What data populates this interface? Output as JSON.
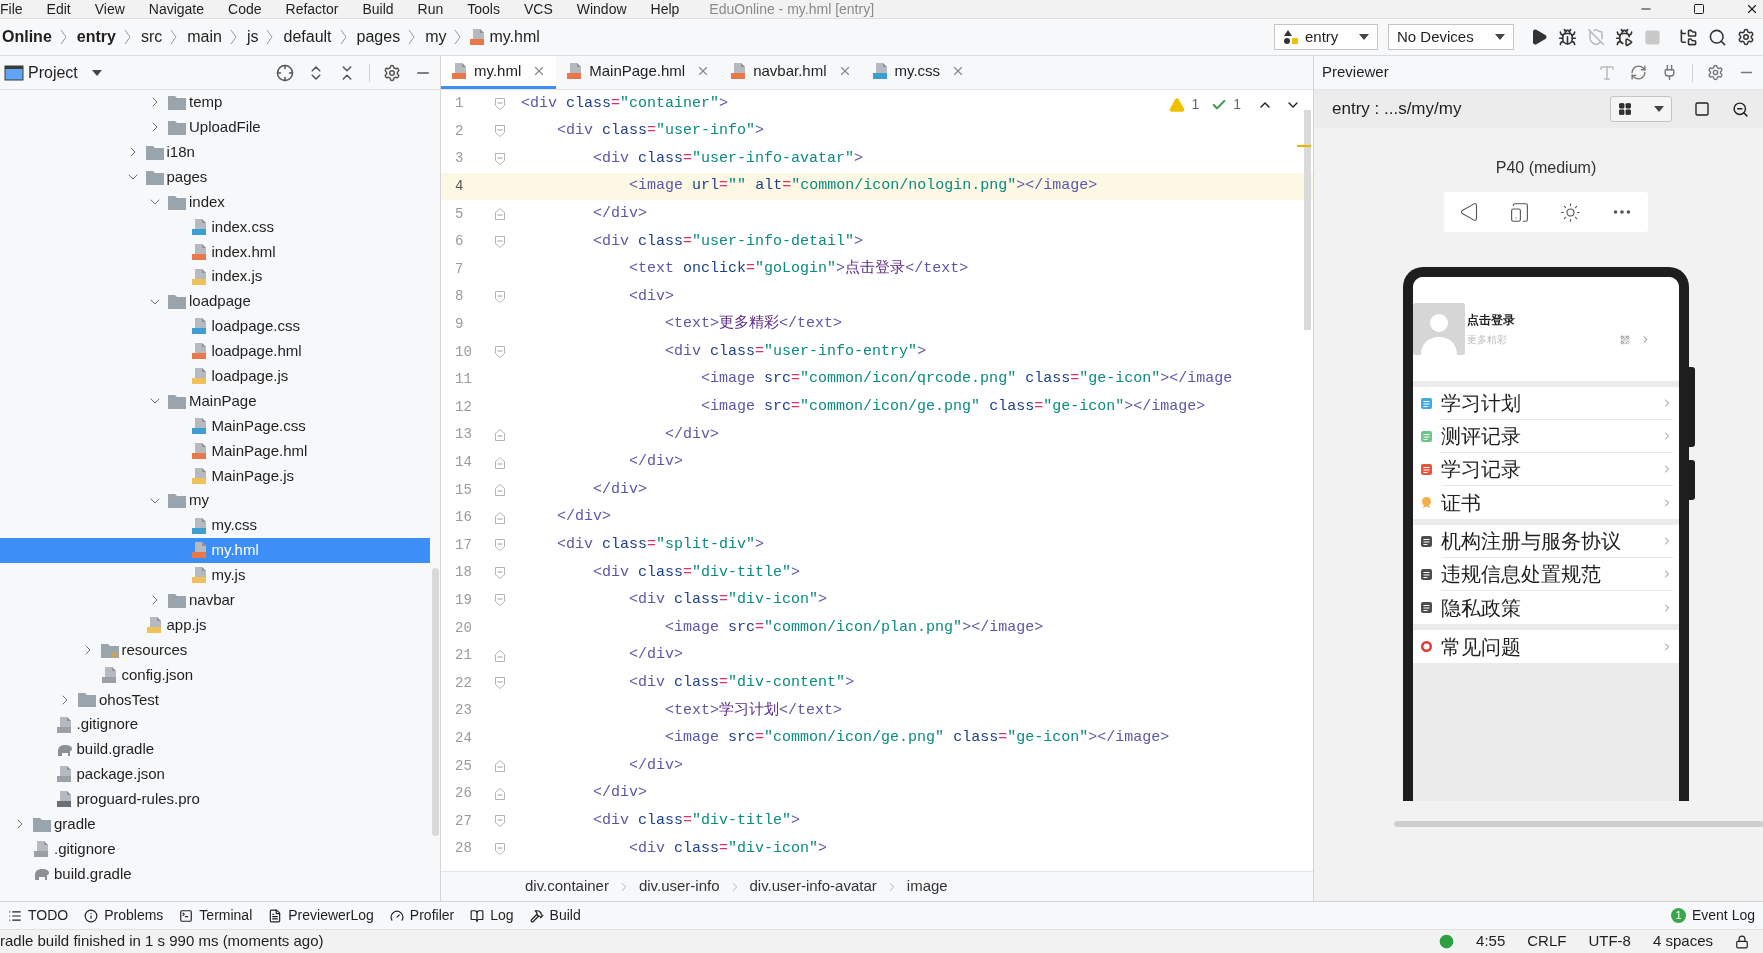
{
  "menu_bar": {
    "items": [
      "File",
      "Edit",
      "View",
      "Navigate",
      "Code",
      "Refactor",
      "Build",
      "Run",
      "Tools",
      "VCS",
      "Window",
      "Help"
    ],
    "title": "EduOnline - my.hml [entry]"
  },
  "breadcrumb": [
    {
      "label": "Online",
      "bold": true,
      "kind": "dir"
    },
    {
      "label": "entry",
      "bold": true,
      "kind": "dir"
    },
    {
      "label": "src",
      "bold": false,
      "kind": "dir"
    },
    {
      "label": "main",
      "bold": false,
      "kind": "dir"
    },
    {
      "label": "js",
      "bold": false,
      "kind": "dir"
    },
    {
      "label": "default",
      "bold": false,
      "kind": "dir"
    },
    {
      "label": "pages",
      "bold": false,
      "kind": "dir"
    },
    {
      "label": "my",
      "bold": false,
      "kind": "dir"
    },
    {
      "label": "my.hml",
      "bold": false,
      "kind": "hml"
    }
  ],
  "run_config": "entry",
  "device": "No Devices",
  "project_panel": {
    "title": "Project",
    "tree": [
      {
        "children": [
          {
            "children": [
              {
                "children": [
                  {
                    "children": [
                      {
                        "children": [
                          {
                            "children": [
                              {
                                "label": "temp",
                                "kind": "folder",
                                "expanded": false,
                                "selected": false
                              },
                              {
                                "label": "UploadFile",
                                "kind": "folder",
                                "expanded": false,
                                "selected": false
                              }
                            ]
                          },
                          {
                            "label": "i18n",
                            "kind": "folder",
                            "expanded": false,
                            "selected": false
                          },
                          {
                            "label": "pages",
                            "kind": "folder",
                            "expanded": true,
                            "selected": false,
                            "children": [
                              {
                                "label": "index",
                                "kind": "folder",
                                "expanded": true,
                                "selected": false,
                                "children": [
                                  {
                                    "label": "index.css",
                                    "kind": "css",
                                    "selected": false
                                  },
                                  {
                                    "label": "index.hml",
                                    "kind": "hml",
                                    "selected": false
                                  },
                                  {
                                    "label": "index.js",
                                    "kind": "js",
                                    "selected": false
                                  }
                                ]
                              },
                              {
                                "label": "loadpage",
                                "kind": "folder",
                                "expanded": true,
                                "selected": false,
                                "children": [
                                  {
                                    "label": "loadpage.css",
                                    "kind": "css",
                                    "selected": false
                                  },
                                  {
                                    "label": "loadpage.hml",
                                    "kind": "hml",
                                    "selected": false
                                  },
                                  {
                                    "label": "loadpage.js",
                                    "kind": "js",
                                    "selected": false
                                  }
                                ]
                              },
                              {
                                "label": "MainPage",
                                "kind": "folder",
                                "expanded": true,
                                "selected": false,
                                "children": [
                                  {
                                    "label": "MainPage.css",
                                    "kind": "css",
                                    "selected": false
                                  },
                                  {
                                    "label": "MainPage.hml",
                                    "kind": "hml",
                                    "selected": false
                                  },
                                  {
                                    "label": "MainPage.js",
                                    "kind": "js",
                                    "selected": false
                                  }
                                ]
                              },
                              {
                                "label": "my",
                                "kind": "folder",
                                "expanded": true,
                                "selected": false,
                                "children": [
                                  {
                                    "label": "my.css",
                                    "kind": "css",
                                    "selected": false
                                  },
                                  {
                                    "label": "my.hml",
                                    "kind": "hml",
                                    "selected": true
                                  },
                                  {
                                    "label": "my.js",
                                    "kind": "js",
                                    "selected": false
                                  }
                                ]
                              },
                              {
                                "label": "navbar",
                                "kind": "folder",
                                "expanded": false,
                                "selected": false
                              }
                            ]
                          },
                          {
                            "label": "app.js",
                            "kind": "js",
                            "selected": false
                          }
                        ]
                      }
                    ]
                  },
                  {
                    "label": "resources",
                    "kind": "resources",
                    "expanded": false,
                    "selected": false
                  },
                  {
                    "label": "config.json",
                    "kind": "json",
                    "selected": false
                  }
                ]
              },
              {
                "label": "ohosTest",
                "kind": "folder",
                "expanded": false,
                "selected": false
              }
            ]
          },
          {
            "label": ".gitignore",
            "kind": "ignore",
            "selected": false
          },
          {
            "label": "build.gradle",
            "kind": "gradle",
            "selected": false
          },
          {
            "label": "package.json",
            "kind": "json",
            "selected": false
          },
          {
            "label": "proguard-rules.pro",
            "kind": "text",
            "selected": false
          }
        ]
      },
      {
        "label": "gradle",
        "kind": "folder",
        "expanded": false,
        "selected": false
      },
      {
        "label": ".gitignore",
        "kind": "ignore",
        "selected": false
      },
      {
        "label": "build.gradle",
        "kind": "gradle",
        "selected": false
      }
    ]
  },
  "editor": {
    "tabs": [
      {
        "label": "my.hml",
        "kind": "hml",
        "selected": true
      },
      {
        "label": "MainPage.hml",
        "kind": "hml",
        "selected": false
      },
      {
        "label": "navbar.hml",
        "kind": "hml",
        "selected": false
      },
      {
        "label": "my.css",
        "kind": "css",
        "selected": false
      }
    ],
    "warnings": "1",
    "weak_warnings": "1",
    "lines": [
      {
        "number": "1",
        "text": "<div class=\"container\">",
        "kind": "open",
        "current": false
      },
      {
        "number": "2",
        "text": "    <div class=\"user-info\">",
        "kind": "open",
        "current": false
      },
      {
        "number": "3",
        "text": "        <div class=\"user-info-avatar\">",
        "kind": "open",
        "current": false
      },
      {
        "number": "4",
        "text": "            <image url=\"\" alt=\"common/icon/nologin.png\"></image>",
        "kind": "plain",
        "current": true
      },
      {
        "number": "5",
        "text": "        </div>",
        "kind": "close",
        "current": false
      },
      {
        "number": "6",
        "text": "        <div class=\"user-info-detail\">",
        "kind": "open",
        "current": false
      },
      {
        "number": "7",
        "text": "            <text onclick=\"goLogin\">点击登录</text>",
        "kind": "plain",
        "current": false
      },
      {
        "number": "8",
        "text": "            <div>",
        "kind": "open",
        "current": false
      },
      {
        "number": "9",
        "text": "                <text>更多精彩</text>",
        "kind": "plain",
        "current": false
      },
      {
        "number": "10",
        "text": "                <div class=\"user-info-entry\">",
        "kind": "open",
        "current": false
      },
      {
        "number": "11",
        "text": "                    <image src=\"common/icon/qrcode.png\" class=\"ge-icon\"></image",
        "kind": "plain",
        "current": false
      },
      {
        "number": "12",
        "text": "                    <image src=\"common/icon/ge.png\" class=\"ge-icon\"></image>",
        "kind": "plain",
        "current": false
      },
      {
        "number": "13",
        "text": "                </div>",
        "kind": "close",
        "current": false
      },
      {
        "number": "14",
        "text": "            </div>",
        "kind": "close",
        "current": false
      },
      {
        "number": "15",
        "text": "        </div>",
        "kind": "close",
        "current": false
      },
      {
        "number": "16",
        "text": "    </div>",
        "kind": "close",
        "current": false
      },
      {
        "number": "17",
        "text": "    <div class=\"split-div\">",
        "kind": "open",
        "current": false
      },
      {
        "number": "18",
        "text": "        <div class=\"div-title\">",
        "kind": "open",
        "current": false
      },
      {
        "number": "19",
        "text": "            <div class=\"div-icon\">",
        "kind": "open",
        "current": false
      },
      {
        "number": "20",
        "text": "                <image src=\"common/icon/plan.png\"></image>",
        "kind": "plain",
        "current": false
      },
      {
        "number": "21",
        "text": "            </div>",
        "kind": "close",
        "current": false
      },
      {
        "number": "22",
        "text": "            <div class=\"div-content\">",
        "kind": "open",
        "current": false
      },
      {
        "number": "23",
        "text": "                <text>学习计划</text>",
        "kind": "plain",
        "current": false
      },
      {
        "number": "24",
        "text": "                <image src=\"common/icon/ge.png\" class=\"ge-icon\"></image>",
        "kind": "plain",
        "current": false
      },
      {
        "number": "25",
        "text": "            </div>",
        "kind": "close",
        "current": false
      },
      {
        "number": "26",
        "text": "        </div>",
        "kind": "close",
        "current": false
      },
      {
        "number": "27",
        "text": "        <div class=\"div-title\">",
        "kind": "open",
        "current": false
      },
      {
        "number": "28",
        "text": "            <div class=\"div-icon\">",
        "kind": "open",
        "current": false
      }
    ],
    "path": [
      "div.container",
      "div.user-info",
      "div.user-info-avatar",
      "image"
    ]
  },
  "previewer": {
    "title": "Previewer",
    "target": "entry : ...s/my/my",
    "device_name": "P40 (medium)",
    "profile": {
      "name": "点击登录",
      "subtitle": "更多精彩"
    },
    "menu_groups": [
      [
        {
          "label": "学习计划",
          "kind": "doc",
          "color": "#3fa9e0"
        },
        {
          "label": "测评记录",
          "kind": "doc",
          "color": "#6cc58a"
        },
        {
          "label": "学习记录",
          "kind": "doc",
          "color": "#e8553b"
        },
        {
          "label": "证书",
          "kind": "award",
          "color": "#f0b04a"
        }
      ],
      [
        {
          "label": "机构注册与服务协议",
          "kind": "policy",
          "color": "#4d4d4d"
        },
        {
          "label": "违规信息处置规范",
          "kind": "policy",
          "color": "#4d4d4d"
        },
        {
          "label": "隐私政策",
          "kind": "policy",
          "color": "#4d4d4d"
        }
      ],
      [
        {
          "label": "常见问题",
          "kind": "help",
          "color": "#e03a3a"
        }
      ]
    ]
  },
  "tool_windows": [
    {
      "label": "TODO"
    },
    {
      "label": "Problems"
    },
    {
      "label": "Terminal"
    },
    {
      "label": "PreviewerLog"
    },
    {
      "label": "Profiler"
    },
    {
      "label": "Log"
    },
    {
      "label": "Build"
    }
  ],
  "event_log": {
    "label": "Event Log",
    "count": "1"
  },
  "status_bar": {
    "message": "radle build finished in 1 s 990 ms (moments ago)",
    "position": "4:55",
    "line_separator": "CRLF",
    "encoding": "UTF-8",
    "indent": "4 spaces"
  }
}
